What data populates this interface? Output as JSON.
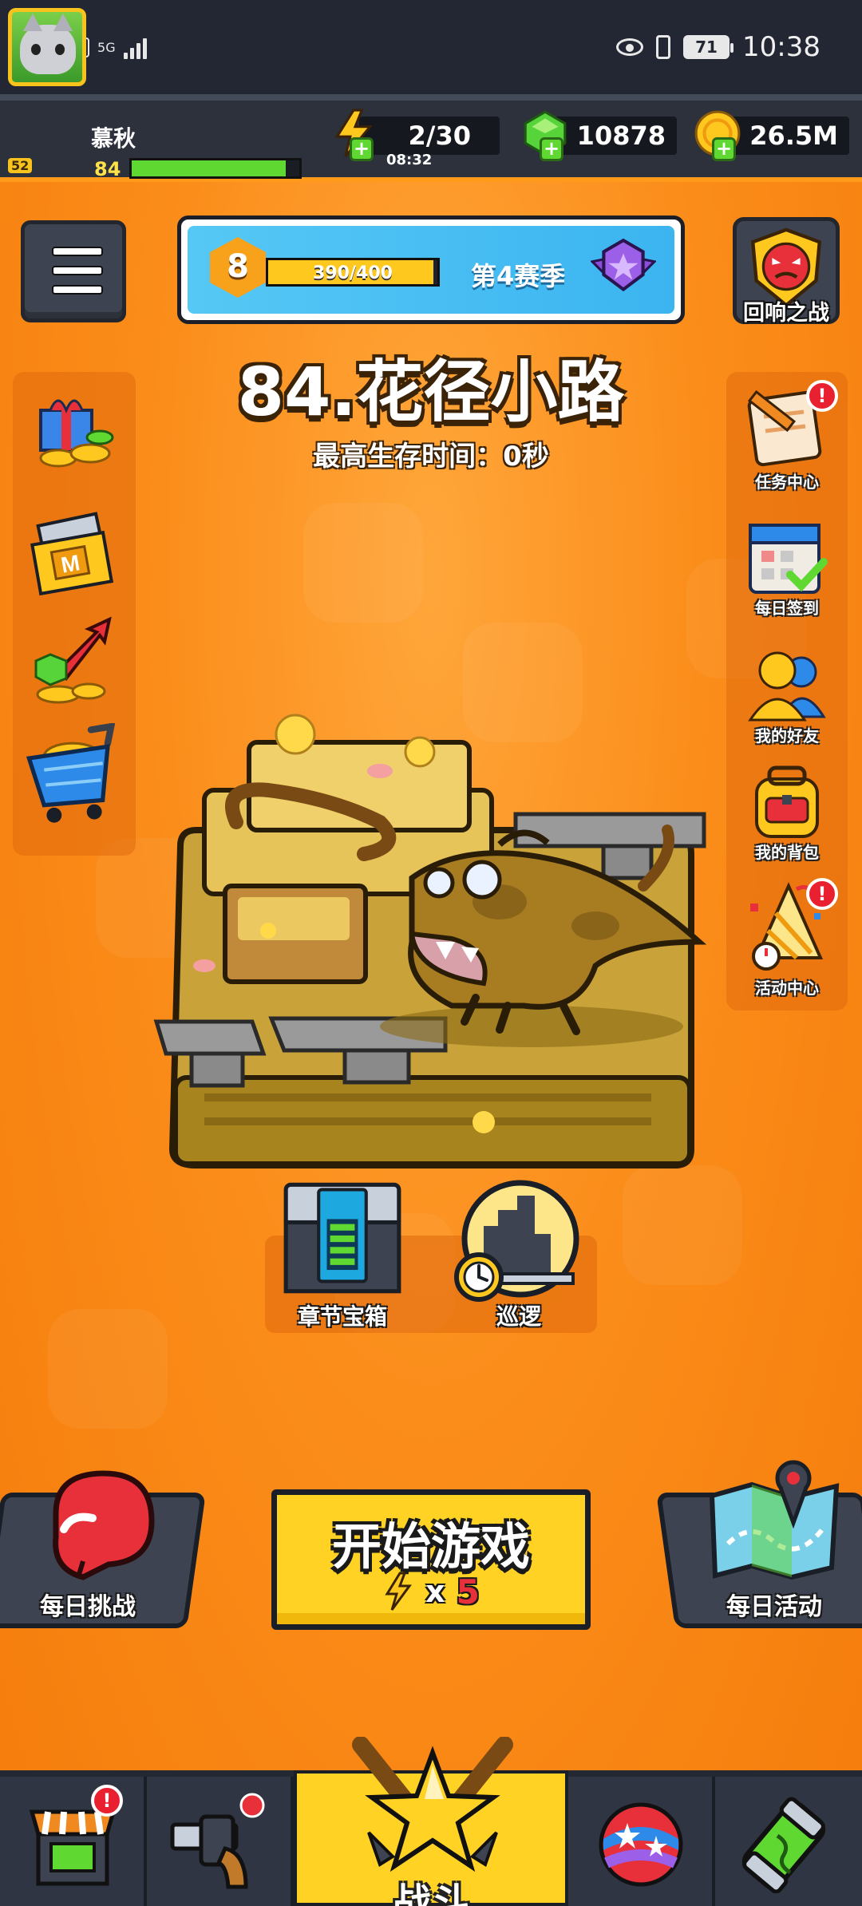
{
  "status_bar": {
    "hd": "HD",
    "network": "5G",
    "battery": "71",
    "time": "10:38"
  },
  "player": {
    "name": "慕秋",
    "level": "84",
    "avatar_badge": "52",
    "xp_fraction": 0.92
  },
  "resources": {
    "energy": "2/30",
    "energy_timer": "08:32",
    "gems": "10878",
    "coins": "26.5M"
  },
  "season": {
    "tier": "8",
    "progress_text": "390/400",
    "progress_fraction": 0.975,
    "name": "第4赛季"
  },
  "echo_battle": {
    "label": "回响之战"
  },
  "stage": {
    "title": "84.花径小路",
    "best_time": "最高生存时间：0秒"
  },
  "right_menu": [
    {
      "label": "任务中心",
      "icon": "quest-scroll-icon",
      "alert": "!"
    },
    {
      "label": "每日签到",
      "icon": "calendar-check-icon"
    },
    {
      "label": "我的好友",
      "icon": "friends-icon"
    },
    {
      "label": "我的背包",
      "icon": "backpack-icon"
    },
    {
      "label": "活动中心",
      "icon": "event-party-icon",
      "alert": "!"
    }
  ],
  "left_menu": [
    {
      "icon": "gift-coins-icon"
    },
    {
      "icon": "monthly-card-icon"
    },
    {
      "icon": "gem-growth-icon"
    },
    {
      "icon": "shopping-cart-icon"
    }
  ],
  "stage_actions": {
    "chest": "章节宝箱",
    "patrol": "巡逻"
  },
  "daily_challenge": {
    "label": "每日挑战"
  },
  "daily_event": {
    "label": "每日活动"
  },
  "start_game": {
    "label": "开始游戏",
    "cost_prefix": "x",
    "cost": "5"
  },
  "bottom_nav": {
    "battle": "战斗",
    "shop_alert": "!",
    "tabs": [
      "shop-icon",
      "weapon-icon",
      "battle-icon",
      "talent-orb-icon",
      "gene-capsule-icon"
    ]
  },
  "colors": {
    "background": "#f98a15",
    "accent_yellow": "#ffd224",
    "dark_panel": "#2c313b",
    "season_blue": "#3bb4f0"
  }
}
